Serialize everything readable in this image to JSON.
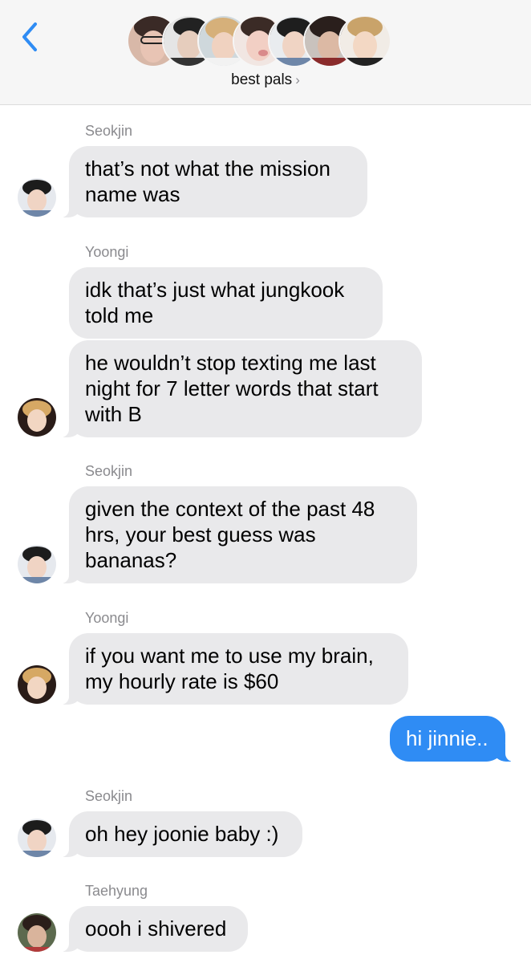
{
  "header": {
    "back_icon": "chevron-left-icon",
    "group_name": "best pals",
    "chevron": "›",
    "member_count": 7
  },
  "messages": [
    {
      "sender": "Seokjin",
      "text": "that’s not what the mission name was"
    },
    {
      "sender": "Yoongi",
      "text": "idk that’s just what jungkook told me"
    },
    {
      "sender": "",
      "text": "he wouldn’t stop texting me last night for 7 letter words that start with B"
    },
    {
      "sender": "Seokjin",
      "text": "given the context of the past 48 hrs, your best guess was bananas?"
    },
    {
      "sender": "Yoongi",
      "text": "if you want me to use my brain, my hourly rate is $60"
    },
    {
      "sender": "",
      "text": "hi jinnie..",
      "outgoing": true
    },
    {
      "sender": "Seokjin",
      "text": "oh hey joonie baby :)"
    },
    {
      "sender": "Taehyung",
      "text": "oooh i shivered"
    }
  ],
  "colors": {
    "accent": "#2f8cf4",
    "incoming_bubble": "#e9e9eb",
    "sender_label": "#8a8a8e",
    "header_bg": "#f6f6f6"
  }
}
